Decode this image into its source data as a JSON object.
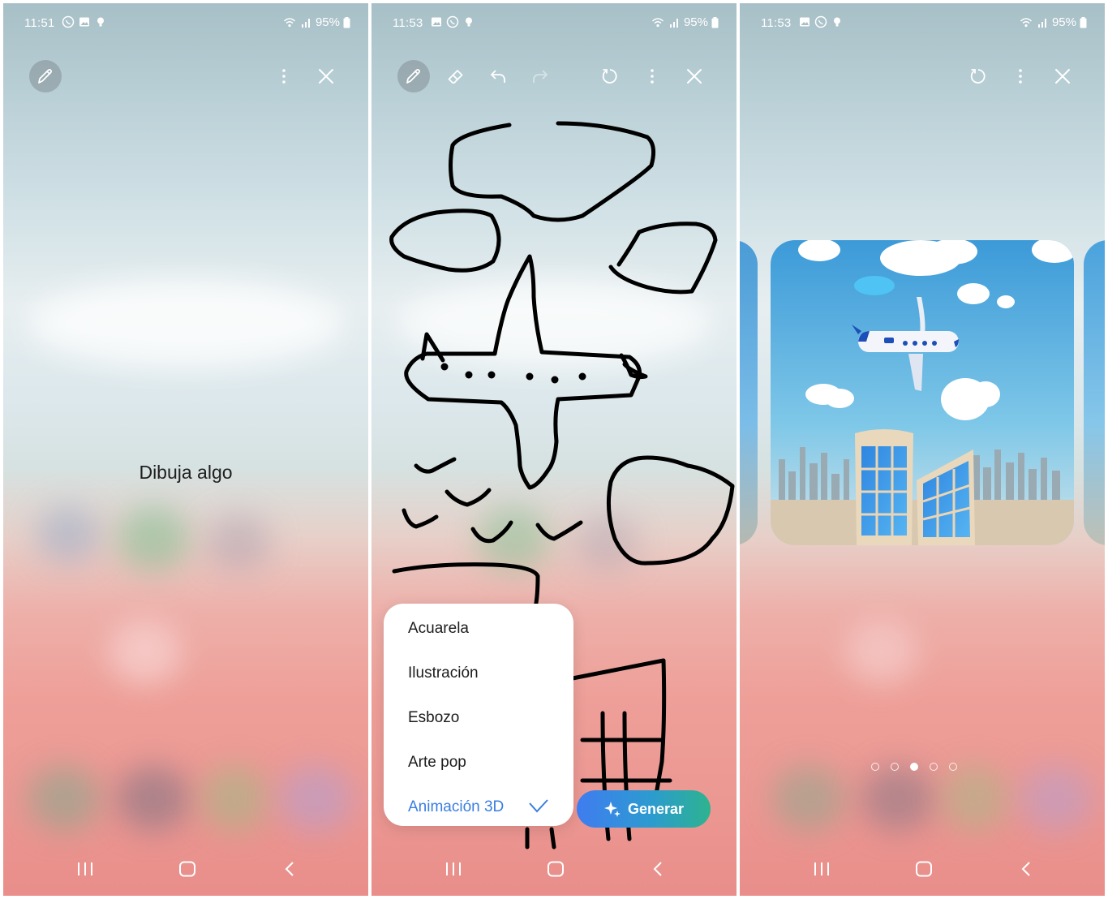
{
  "panels": [
    {
      "status": {
        "time": "11:51",
        "battery": "95%"
      },
      "toolbar": [
        "pen-icon",
        "more-icon",
        "close-icon"
      ],
      "hint": "Dibuja algo"
    },
    {
      "status": {
        "time": "11:53",
        "battery": "95%"
      },
      "toolbar": [
        "pen-icon",
        "eraser-icon",
        "undo-icon",
        "redo-icon",
        "reset-icon",
        "more-icon",
        "close-icon"
      ],
      "style_menu": {
        "options": [
          "Acuarela",
          "Ilustración",
          "Esbozo",
          "Arte pop",
          "Animación 3D"
        ],
        "selected": "Animación 3D"
      },
      "generate_label": "Generar"
    },
    {
      "status": {
        "time": "11:53",
        "battery": "95%"
      },
      "toolbar": [
        "reset-icon",
        "more-icon",
        "close-icon"
      ],
      "carousel": {
        "total": 5,
        "current_index": 3
      }
    }
  ],
  "colors": {
    "accent": "#3a7ee0",
    "generate_start": "#3f7cf0",
    "generate_end": "#2db38f"
  }
}
